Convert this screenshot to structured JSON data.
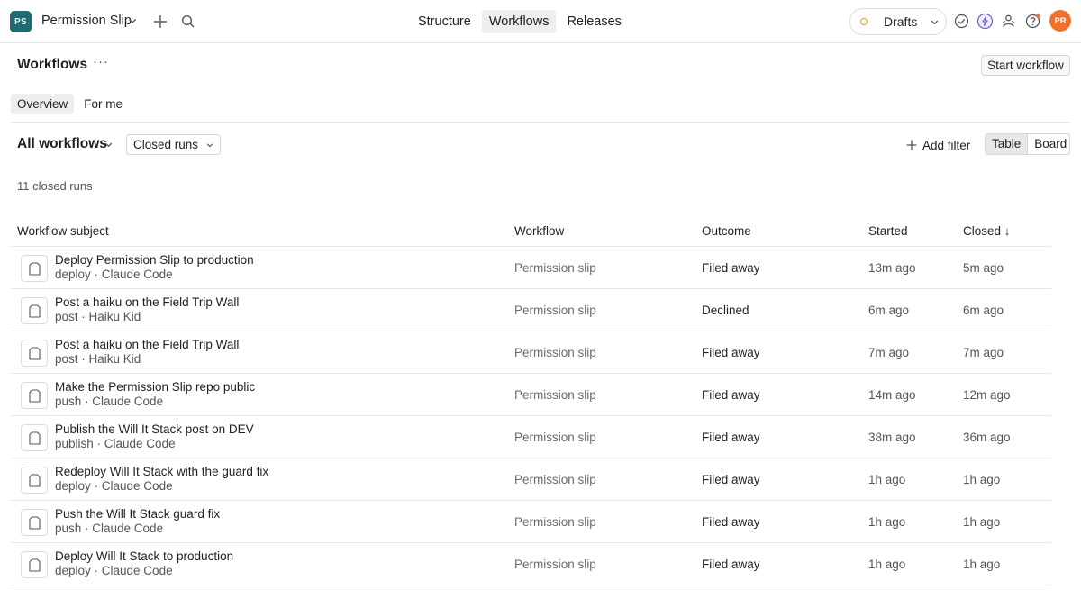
{
  "topbar": {
    "app_badge": "PS",
    "app_name": "Permission Slip",
    "nav": [
      "Structure",
      "Workflows",
      "Releases"
    ],
    "active_nav": "Workflows",
    "drafts_label": "Drafts",
    "avatar": "PR"
  },
  "page": {
    "title": "Workflows",
    "more": "···",
    "start_button": "Start workflow",
    "subtabs": [
      "Overview",
      "For me"
    ]
  },
  "filters": {
    "all_workflows": "All workflows",
    "closed_runs": "Closed runs",
    "add_filter": "Add filter",
    "views": [
      "Table",
      "Board"
    ]
  },
  "count_text": "11 closed runs",
  "table": {
    "headers": {
      "subject": "Workflow subject",
      "workflow": "Workflow",
      "outcome": "Outcome",
      "started": "Started",
      "closed": "Closed ↓"
    },
    "rows": [
      {
        "subject": "Deploy Permission Slip to production",
        "meta": "deploy · Claude Code",
        "workflow": "Permission slip",
        "outcome": "Filed away",
        "started": "13m ago",
        "closed": "5m ago"
      },
      {
        "subject": "Post a haiku on the Field Trip Wall",
        "meta": "post · Haiku Kid",
        "workflow": "Permission slip",
        "outcome": "Declined",
        "started": "6m ago",
        "closed": "6m ago"
      },
      {
        "subject": "Post a haiku on the Field Trip Wall",
        "meta": "post · Haiku Kid",
        "workflow": "Permission slip",
        "outcome": "Filed away",
        "started": "7m ago",
        "closed": "7m ago"
      },
      {
        "subject": "Make the Permission Slip repo public",
        "meta": "push · Claude Code",
        "workflow": "Permission slip",
        "outcome": "Filed away",
        "started": "14m ago",
        "closed": "12m ago"
      },
      {
        "subject": "Publish the Will It Stack post on DEV",
        "meta": "publish · Claude Code",
        "workflow": "Permission slip",
        "outcome": "Filed away",
        "started": "38m ago",
        "closed": "36m ago"
      },
      {
        "subject": "Redeploy Will It Stack with the guard fix",
        "meta": "deploy · Claude Code",
        "workflow": "Permission slip",
        "outcome": "Filed away",
        "started": "1h ago",
        "closed": "1h ago"
      },
      {
        "subject": "Push the Will It Stack guard fix",
        "meta": "push · Claude Code",
        "workflow": "Permission slip",
        "outcome": "Filed away",
        "started": "1h ago",
        "closed": "1h ago"
      },
      {
        "subject": "Deploy Will It Stack to production",
        "meta": "deploy · Claude Code",
        "workflow": "Permission slip",
        "outcome": "Filed away",
        "started": "1h ago",
        "closed": "1h ago"
      }
    ]
  }
}
